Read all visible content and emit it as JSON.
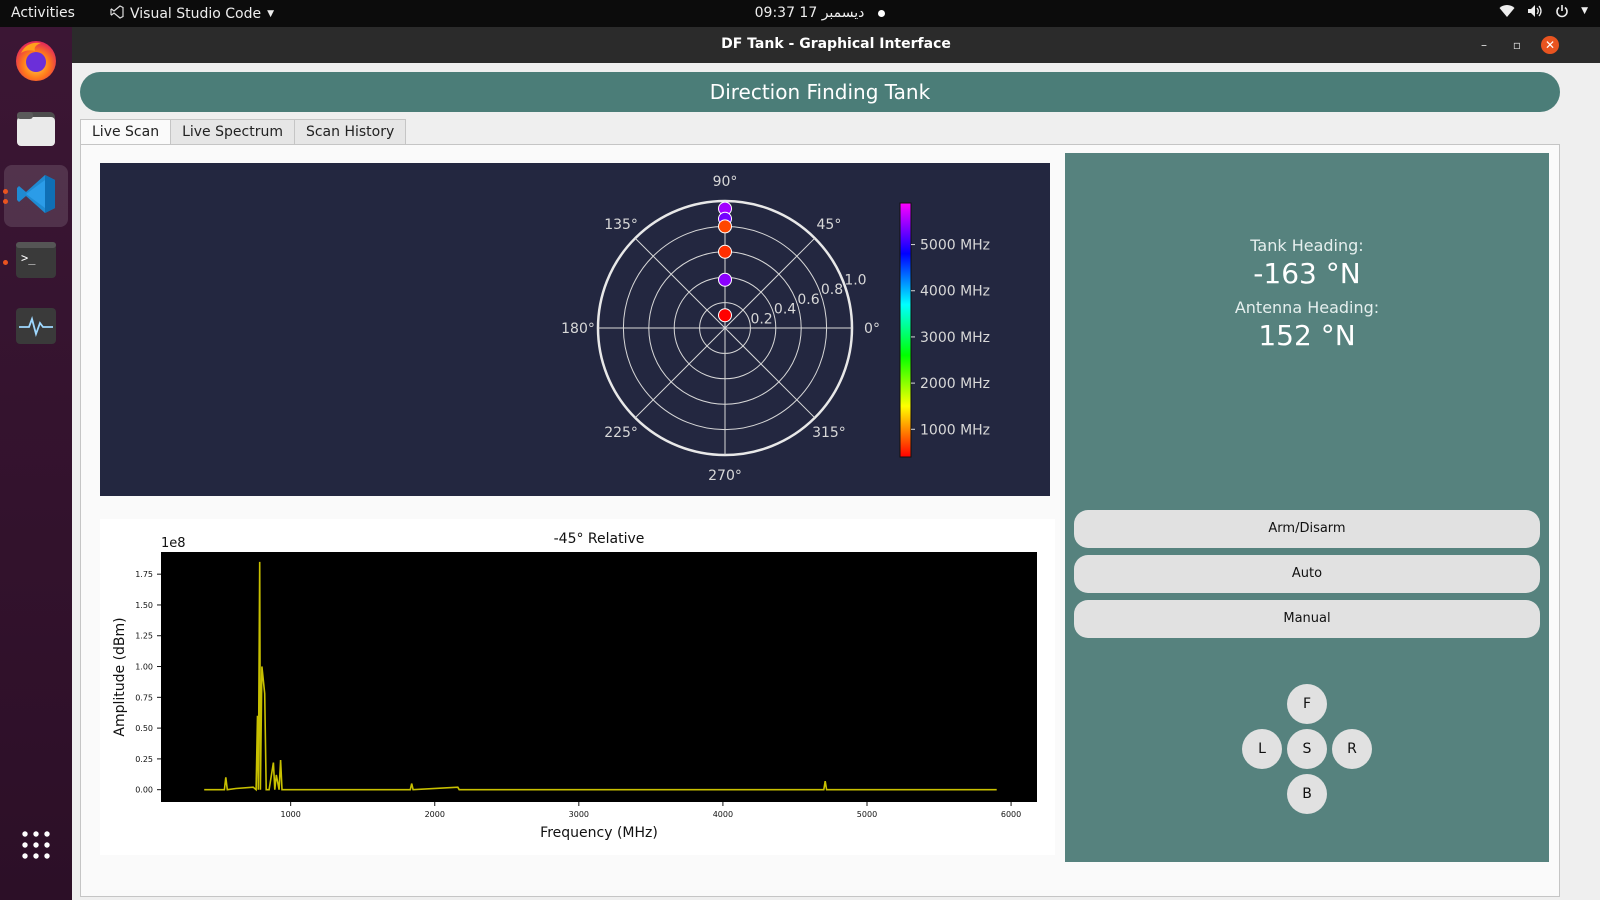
{
  "topbar": {
    "activities": "Activities",
    "app_name": "Visual Studio Code",
    "clock": "09:37  17 ديسمبر"
  },
  "dock": {
    "items": [
      {
        "name": "firefox-icon"
      },
      {
        "name": "files-icon"
      },
      {
        "name": "vscode-icon"
      },
      {
        "name": "terminal-icon"
      },
      {
        "name": "system-monitor-icon"
      },
      {
        "name": "app-grid-icon"
      }
    ]
  },
  "window": {
    "title": "DF Tank - Graphical Interface",
    "controls": {
      "minimize": "–",
      "maximize": "▫",
      "close": "✕"
    }
  },
  "app": {
    "banner": "Direction Finding Tank",
    "tabs": [
      "Live Scan",
      "Live Spectrum",
      "Scan History"
    ],
    "active_tab": "Live Scan",
    "tank_heading_label": "Tank Heading:",
    "tank_heading_value": "-163 °N",
    "antenna_heading_label": "Antenna Heading:",
    "antenna_heading_value": "152 °N",
    "buttons": {
      "arm": "Arm/Disarm",
      "auto": "Auto",
      "manual": "Manual"
    },
    "dpad": {
      "forward": "F",
      "left": "L",
      "stop": "S",
      "right": "R",
      "back": "B"
    }
  },
  "chart_data": [
    {
      "type": "scatter",
      "subtype": "polar",
      "angle_ticks": [
        "90°",
        "45°",
        "0°",
        "315°",
        "270°",
        "225°",
        "180°",
        "135°"
      ],
      "radial_ticks": [
        "0.2",
        "0.4",
        "0.6",
        "0.8",
        "1.0"
      ],
      "rlim": [
        0,
        1.0
      ],
      "points": [
        {
          "theta": 90,
          "r": 0.94,
          "freq_mhz": 5500
        },
        {
          "theta": 90,
          "r": 0.86,
          "freq_mhz": 5300
        },
        {
          "theta": 90,
          "r": 0.8,
          "freq_mhz": 700
        },
        {
          "theta": 90,
          "r": 0.6,
          "freq_mhz": 600
        },
        {
          "theta": 90,
          "r": 0.38,
          "freq_mhz": 5400
        },
        {
          "theta": 90,
          "r": 0.1,
          "freq_mhz": 400
        }
      ],
      "colorbar": {
        "ticks": [
          "1000 MHz",
          "2000 MHz",
          "3000 MHz",
          "4000 MHz",
          "5000 MHz"
        ],
        "range": [
          400,
          5900
        ]
      }
    },
    {
      "type": "line",
      "title": "-45° Relative",
      "xlabel": "Frequency (MHz)",
      "ylabel": "Amplitude (dBm)",
      "y_multiplier": "1e8",
      "xlim": [
        100,
        6180
      ],
      "ylim": [
        -0.1,
        1.93
      ],
      "x_ticks": [
        "1000",
        "2000",
        "3000",
        "4000",
        "5000",
        "6000"
      ],
      "y_ticks": [
        "0.00",
        "0.25",
        "0.50",
        "0.75",
        "1.00",
        "1.25",
        "1.50",
        "1.75"
      ],
      "series": [
        {
          "color": "#c8c000",
          "x": [
            400,
            540,
            550,
            560,
            620,
            740,
            760,
            770,
            775,
            785,
            790,
            800,
            820,
            830,
            850,
            880,
            890,
            900,
            920,
            930,
            940,
            1500,
            1830,
            1840,
            1850,
            2160,
            2170,
            4700,
            4710,
            4720,
            5900
          ],
          "y": [
            0,
            0,
            0.1,
            0,
            0.01,
            0.02,
            0,
            0.6,
            0,
            1.85,
            0,
            1.0,
            0.78,
            0,
            0,
            0.22,
            0,
            0.12,
            0,
            0.24,
            0,
            0,
            0,
            0.05,
            0,
            0.02,
            0,
            0,
            0.07,
            0,
            0
          ]
        }
      ]
    }
  ]
}
